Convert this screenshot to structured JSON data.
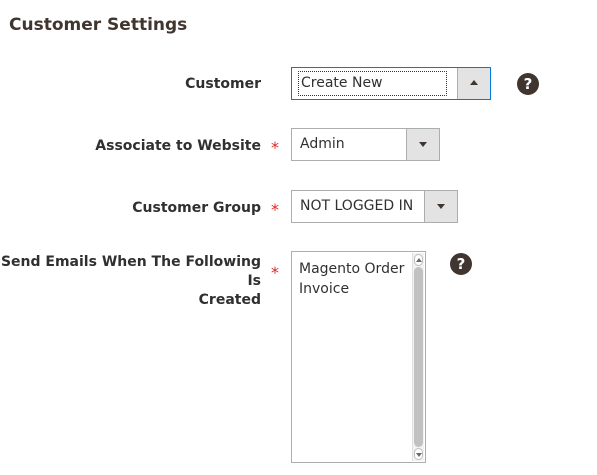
{
  "section": {
    "title": "Customer Settings"
  },
  "fields": {
    "customer": {
      "label": "Customer",
      "value": "Create New",
      "help_icon": "question-mark-icon"
    },
    "website": {
      "label": "Associate to Website",
      "required_mark": "*",
      "value": "Admin"
    },
    "group": {
      "label": "Customer Group",
      "required_mark": "*",
      "value": "NOT LOGGED IN"
    },
    "emails": {
      "label_line1": "Send Emails When The Following Is",
      "label_line2": "Created",
      "required_mark": "*",
      "options": [
        "Magento Order",
        "Invoice"
      ],
      "help_icon": "question-mark-icon"
    }
  },
  "help_glyph": "?",
  "colors": {
    "accent": "#007bdb",
    "required": "#e22626",
    "icon_dark": "#41362f"
  }
}
